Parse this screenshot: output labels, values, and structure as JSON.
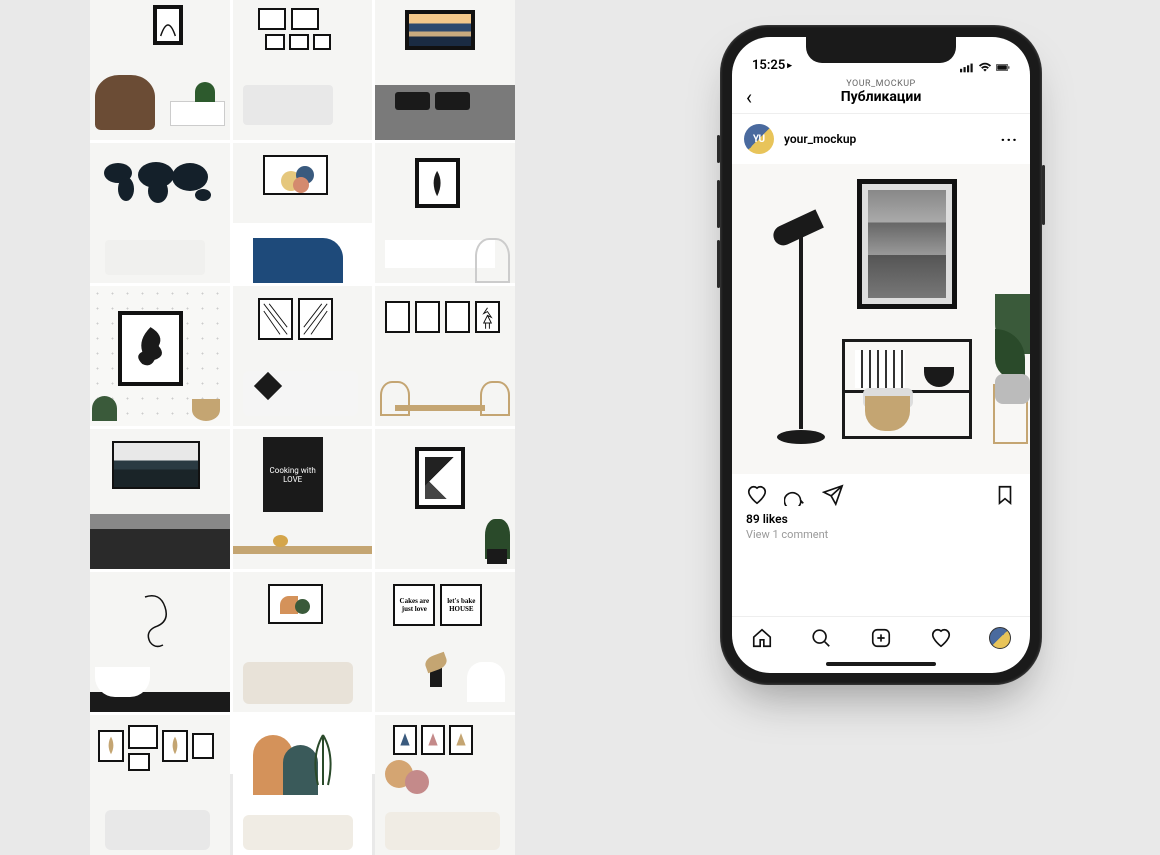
{
  "grid": {
    "tiles": [
      {
        "name": "tile-chair-print"
      },
      {
        "name": "tile-sofa-gallery"
      },
      {
        "name": "tile-bed-landscape"
      },
      {
        "name": "tile-worldmap-sofa"
      },
      {
        "name": "tile-bed-circles"
      },
      {
        "name": "tile-shelf-leaf"
      },
      {
        "name": "tile-dotted-portrait"
      },
      {
        "name": "tile-sofa-twoframes"
      },
      {
        "name": "tile-dining-fourframes"
      },
      {
        "name": "tile-bed-forest"
      },
      {
        "name": "tile-kitchen-chalkboard",
        "chalk_text": "Cooking with LOVE"
      },
      {
        "name": "tile-abstract-plant"
      },
      {
        "name": "tile-bath-lineart"
      },
      {
        "name": "tile-sofa-shapes"
      },
      {
        "name": "tile-cakes-frames",
        "f1_text": "Cakes are just love",
        "f2_text": "let's bake HOUSE"
      },
      {
        "name": "tile-gallery-leaf"
      },
      {
        "name": "tile-arches-leaf"
      },
      {
        "name": "tile-triangles-sofa"
      }
    ]
  },
  "phone": {
    "status": {
      "time": "15:25",
      "play_icon": "▸"
    },
    "header": {
      "subtitle": "YOUR_MOCKUP",
      "title": "Публикации"
    },
    "post": {
      "avatar_initials": "YU",
      "username": "your_mockup",
      "likes_label": "89 likes",
      "comments_label": "View 1 comment"
    }
  }
}
